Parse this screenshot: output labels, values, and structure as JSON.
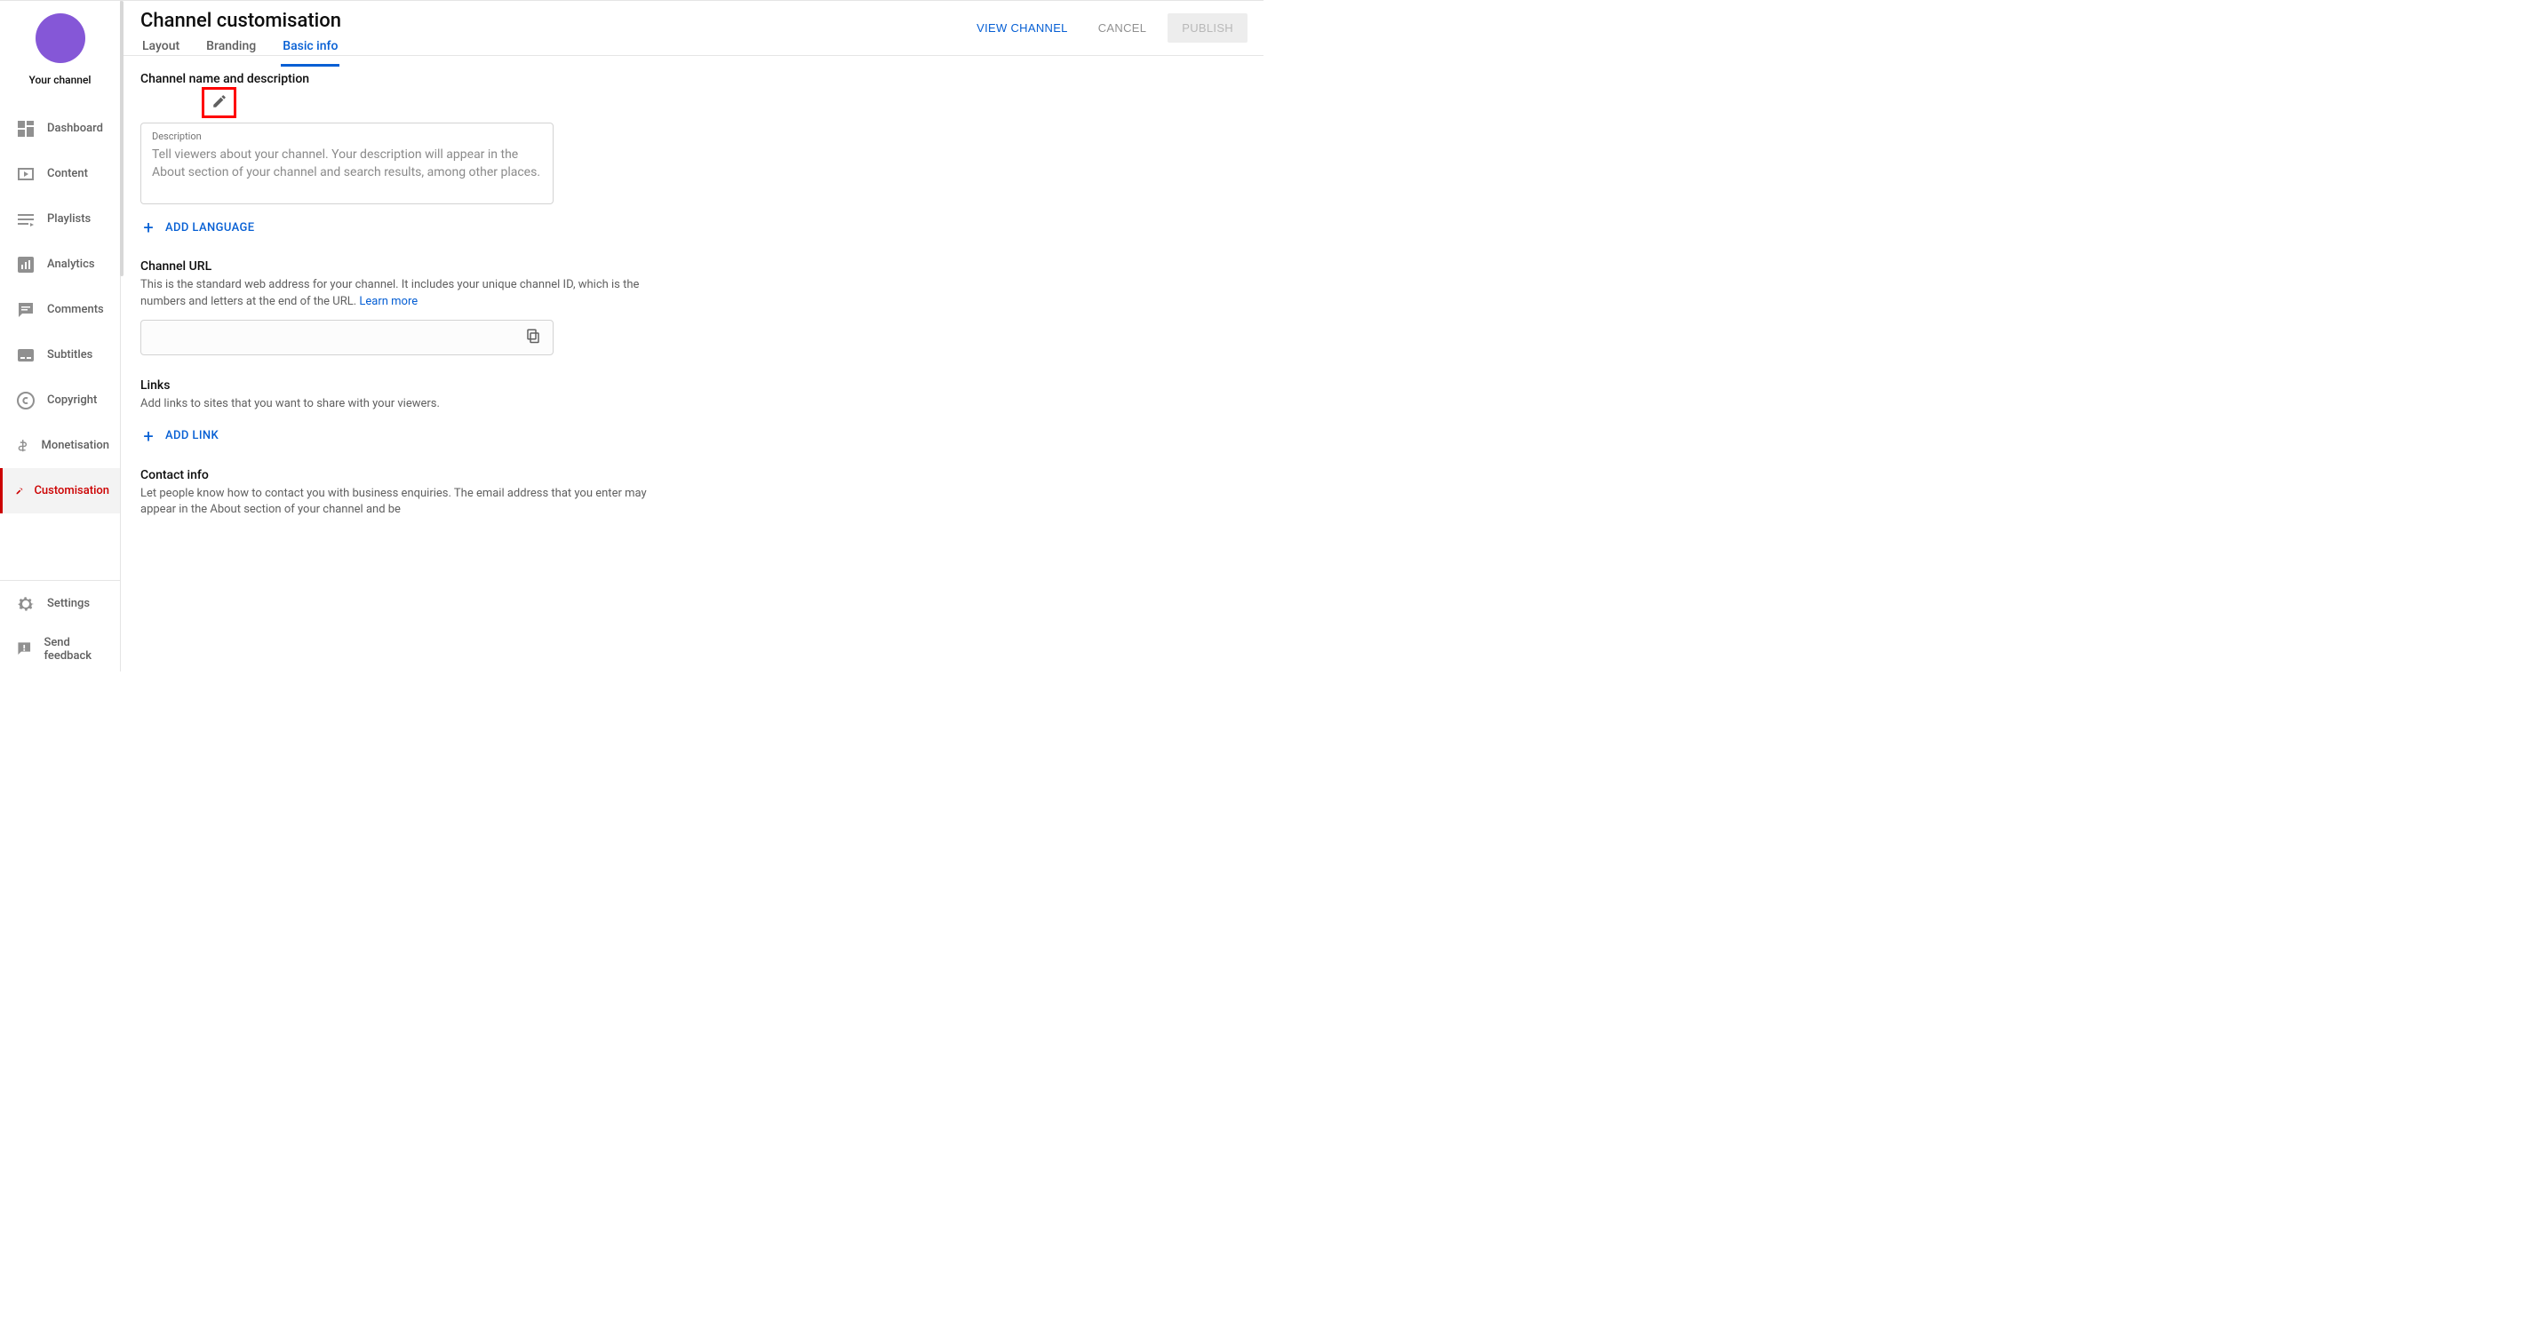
{
  "sidebar": {
    "channel_label": "Your channel",
    "items": [
      {
        "label": "Dashboard"
      },
      {
        "label": "Content"
      },
      {
        "label": "Playlists"
      },
      {
        "label": "Analytics"
      },
      {
        "label": "Comments"
      },
      {
        "label": "Subtitles"
      },
      {
        "label": "Copyright"
      },
      {
        "label": "Monetisation"
      },
      {
        "label": "Customisation"
      }
    ],
    "bottom": [
      {
        "label": "Settings"
      },
      {
        "label": "Send feedback"
      }
    ]
  },
  "header": {
    "title": "Channel customisation",
    "tabs": [
      {
        "label": "Layout"
      },
      {
        "label": "Branding"
      },
      {
        "label": "Basic info"
      }
    ],
    "view_channel": "VIEW CHANNEL",
    "cancel": "CANCEL",
    "publish": "PUBLISH"
  },
  "sections": {
    "nameDesc": {
      "title": "Channel name and description",
      "desc_label": "Description",
      "desc_placeholder": "Tell viewers about your channel. Your description will appear in the About section of your channel and search results, among other places."
    },
    "addLanguage": "ADD LANGUAGE",
    "channelUrl": {
      "title": "Channel URL",
      "desc": "This is the standard web address for your channel. It includes your unique channel ID, which is the numbers and letters at the end of the URL. ",
      "learn_more": "Learn more",
      "value": ""
    },
    "links": {
      "title": "Links",
      "desc": "Add links to sites that you want to share with your viewers.",
      "add_link": "ADD LINK"
    },
    "contact": {
      "title": "Contact info",
      "desc": "Let people know how to contact you with business enquiries. The email address that you enter may appear in the About section of your channel and be"
    }
  }
}
